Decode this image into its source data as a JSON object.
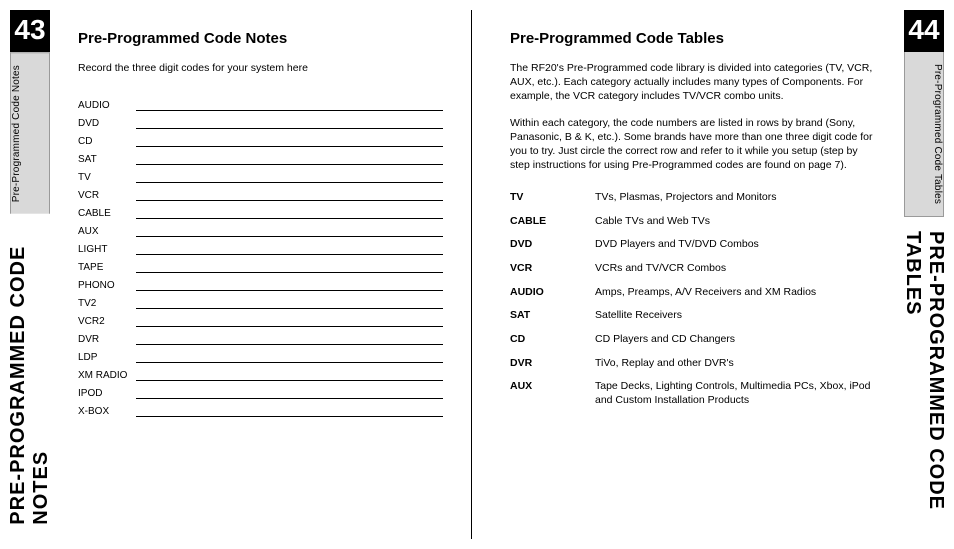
{
  "leftPage": {
    "number": "43",
    "marginTab": "Pre-Programmed Code Notes",
    "sectionTitle": "PRE-PROGRAMMED CODE NOTES",
    "heading": "Pre-Programmed Code Notes",
    "intro": "Record the three digit codes for your system here",
    "fields": [
      "AUDIO",
      "DVD",
      "CD",
      "SAT",
      "TV",
      "VCR",
      "CABLE",
      "AUX",
      "LIGHT",
      "TAPE",
      "PHONO",
      "TV2",
      "VCR2",
      "DVR",
      "LDP",
      "XM RADIO",
      "IPOD",
      "X-BOX"
    ]
  },
  "rightPage": {
    "number": "44",
    "marginTab": "Pre-Programmed Code Tables",
    "sectionTitle": "PRE-PROGRAMMED CODE TABLES",
    "heading": "Pre-Programmed Code Tables",
    "para1": "The RF20's Pre-Programmed code library is divided into categories (TV, VCR, AUX, etc.). Each category actually includes many types of Components. For example, the VCR category includes TV/VCR combo units.",
    "para2": "Within each category, the code numbers are listed in rows by brand (Sony, Panasonic, B & K, etc.). Some brands have more than one three digit code for you to try. Just circle the correct row and refer to it while you setup (step by step instructions for using Pre-Programmed codes are found on page 7).",
    "categories": [
      {
        "key": "TV",
        "desc": "TVs, Plasmas, Projectors and Monitors"
      },
      {
        "key": "CABLE",
        "desc": "Cable TVs and Web TVs"
      },
      {
        "key": "DVD",
        "desc": "DVD Players and TV/DVD Combos"
      },
      {
        "key": "VCR",
        "desc": "VCRs and TV/VCR Combos"
      },
      {
        "key": "AUDIO",
        "desc": "Amps, Preamps, A/V Receivers and XM Radios"
      },
      {
        "key": "SAT",
        "desc": "Satellite Receivers"
      },
      {
        "key": "CD",
        "desc": "CD Players and CD Changers"
      },
      {
        "key": "DVR",
        "desc": "TiVo, Replay and other DVR's"
      },
      {
        "key": "AUX",
        "desc": "Tape Decks, Lighting Controls, Multimedia PCs, Xbox, iPod and Custom Installation Products"
      }
    ]
  }
}
